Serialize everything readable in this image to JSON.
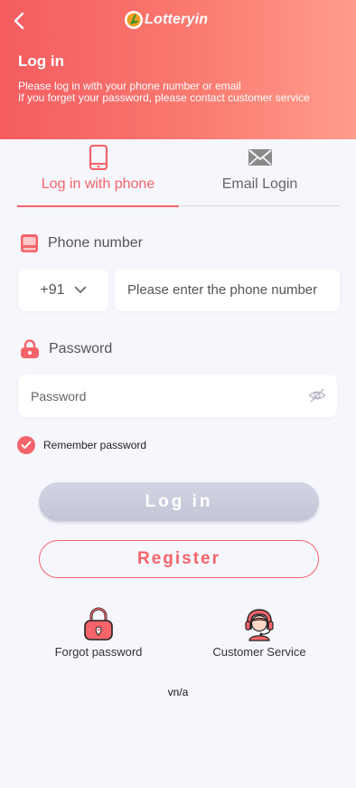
{
  "header": {
    "logo_text": "Lotteryin",
    "title": "Log in",
    "subtitle_line1": "Please log in with your phone number or email",
    "subtitle_line2": "If you forget your password, please contact customer service"
  },
  "tabs": [
    {
      "label": "Log in with phone",
      "icon": "phone-icon",
      "active": true
    },
    {
      "label": "Email Login",
      "icon": "envelope-icon",
      "active": false
    }
  ],
  "phone": {
    "label": "Phone number",
    "country_code": "+91",
    "placeholder": "Please enter the phone number"
  },
  "password": {
    "label": "Password",
    "placeholder": "Password"
  },
  "remember": {
    "label": "Remember password",
    "checked": true
  },
  "buttons": {
    "login": "Log in",
    "register": "Register"
  },
  "links": {
    "forgot": "Forgot password",
    "service": "Customer Service"
  },
  "footer": "vn/a",
  "colors": {
    "accent": "#f4646a",
    "header_start": "#f45c60",
    "header_end": "#ff9d8d",
    "background": "#f6f6fd"
  }
}
